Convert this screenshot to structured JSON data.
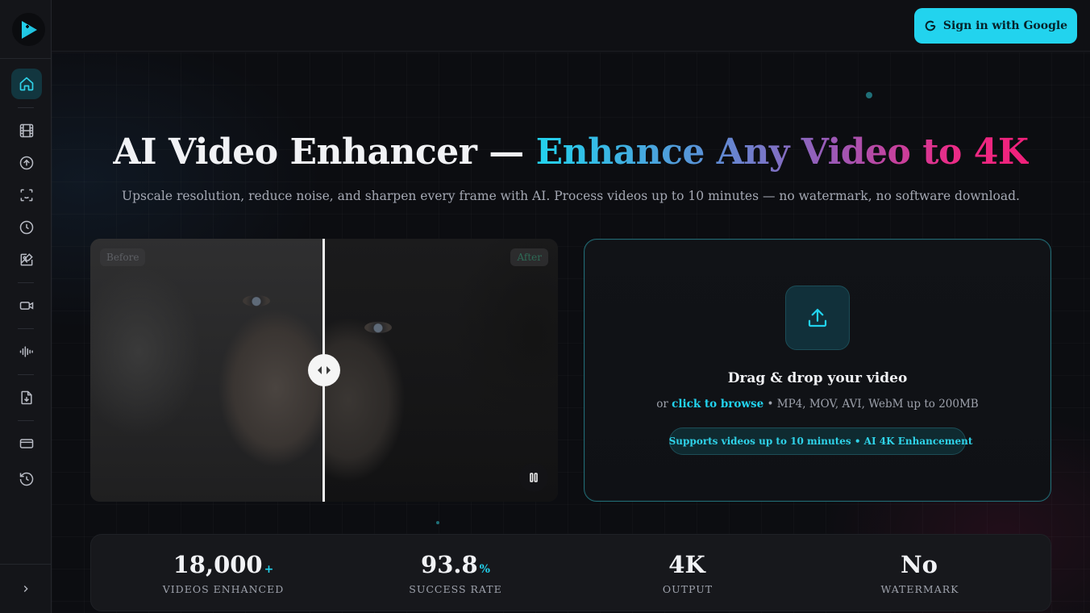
{
  "header": {
    "signin_label": "Sign in with Google"
  },
  "sidebar": {
    "items": [
      {
        "icon": "home-icon",
        "active": true
      },
      {
        "icon": "film-icon"
      },
      {
        "icon": "upload-circle-icon"
      },
      {
        "icon": "face-scan-icon"
      },
      {
        "icon": "clock-icon"
      },
      {
        "icon": "image-edit-icon"
      },
      {
        "icon": "video-camera-icon"
      },
      {
        "icon": "audio-wave-icon"
      },
      {
        "icon": "file-download-icon"
      },
      {
        "icon": "credit-card-icon"
      },
      {
        "icon": "history-icon"
      }
    ],
    "expand_icon": "chevron-right-icon"
  },
  "hero": {
    "title_plain": "AI Video Enhancer — ",
    "title_gradient": "Enhance Any Video to 4K",
    "subtitle": "Upscale resolution, reduce noise, and sharpen every frame with AI. Process videos up to 10 minutes — no watermark, no software download."
  },
  "compare": {
    "before_label": "Before",
    "after_label": "After",
    "slider_position": 0.5
  },
  "upload": {
    "title": "Drag & drop your video",
    "sub_prefix": "or ",
    "browse_link": "click to browse",
    "sub_suffix": " • MP4, MOV, AVI, WebM up to 200MB",
    "pill_text": "Supports videos up to 10 minutes • AI 4K Enhancement"
  },
  "stats": [
    {
      "value": "18,000",
      "suffix": "+",
      "label": "VIDEOS ENHANCED"
    },
    {
      "value": "93.8",
      "suffix": "%",
      "label": "SUCCESS RATE"
    },
    {
      "value": "4K",
      "suffix": "",
      "label": "OUTPUT"
    },
    {
      "value": "No",
      "suffix": "",
      "label": "WATERMARK"
    }
  ],
  "colors": {
    "accent": "#22d3ee",
    "gradient_end": "#ec2b86",
    "background": "#0d0e12"
  }
}
